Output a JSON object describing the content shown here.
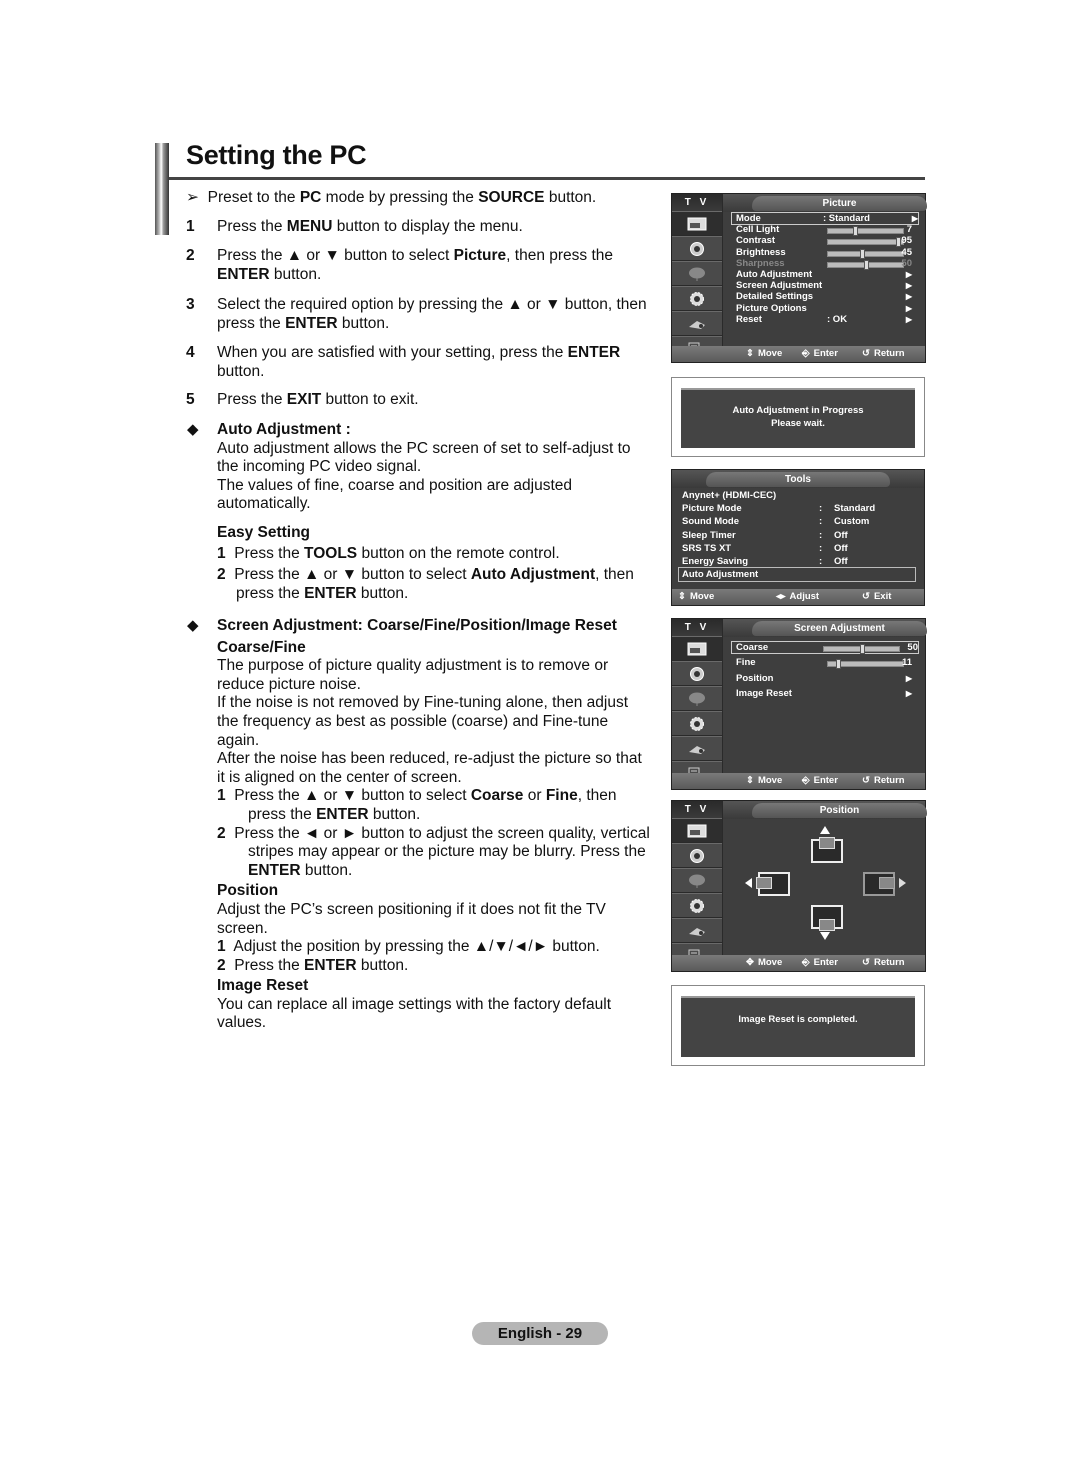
{
  "page": {
    "title": "Setting the PC",
    "footer": "English - 29"
  },
  "intro": {
    "preset_pre": "Preset to the ",
    "preset_b1": "PC",
    "preset_mid": " mode by pressing the ",
    "preset_b2": "SOURCE",
    "preset_post": " button."
  },
  "steps": [
    {
      "num": "1",
      "pre": "Press the ",
      "b": "MENU",
      "post": " button to display the menu."
    },
    {
      "num": "2",
      "line1_pre": "Press the ▲ or ▼ button to select ",
      "line1_b": "Picture",
      "line1_post": ", then press the",
      "line2_b": "ENTER",
      "line2_post": " button."
    },
    {
      "num": "3",
      "line1": "Select the required option by pressing the ▲ or ▼ button, then",
      "line2_pre": "press the ",
      "line2_b": "ENTER",
      "line2_post": " button."
    },
    {
      "num": "4",
      "line1_pre": "When you are satisfied with your setting, press the ",
      "line1_b": "ENTER",
      "line2": "button."
    },
    {
      "num": "5",
      "pre": "Press the ",
      "b": "EXIT",
      "post": " button to exit."
    }
  ],
  "auto_adjustment": {
    "bullet": "◆",
    "heading": "Auto Adjustment :",
    "lines": [
      "Auto adjustment allows the PC screen of set to self-adjust to",
      "the incoming PC video signal.",
      "The values of fine, coarse and position are adjusted",
      "automatically."
    ],
    "easy_heading": "Easy Setting",
    "easy_steps": [
      {
        "num": "1",
        "pre": "Press the ",
        "b": "TOOLS",
        "post": " button on the remote control."
      },
      {
        "num": "2",
        "pre": "Press the ▲ or ▼ button to select ",
        "b": "Auto Adjustment",
        "post": ", then",
        "line2_pre": "press the ",
        "line2_b": "ENTER",
        "line2_post": " button."
      }
    ]
  },
  "screen_adjustment": {
    "bullet": "◆",
    "heading": "Screen Adjustment: Coarse/Fine/Position/Image Reset",
    "coarse_heading": "Coarse/Fine",
    "coarse_lines": [
      "The purpose of picture quality adjustment is to remove or",
      "reduce picture noise.",
      "If the noise is not removed by Fine-tuning alone, then adjust",
      "the frequency as best as possible (coarse) and Fine-tune",
      "again.",
      "After the noise has been reduced, re-adjust the picture so that",
      "it is aligned on the center of screen."
    ],
    "coarse_steps": [
      {
        "num": "1",
        "pre": "Press the ▲ or ▼ button to select ",
        "b1": "Coarse",
        "mid": " or ",
        "b2": "Fine",
        "post": ", then",
        "line2_pre": "press the ",
        "line2_b": "ENTER",
        "line2_post": " button."
      },
      {
        "num": "2",
        "line1": "Press the ◄ or ► button to adjust the screen quality, vertical",
        "line2": "stripes may appear or the picture may be blurry. Press the",
        "line3_b": "ENTER",
        "line3_post": " button."
      }
    ],
    "position_heading": "Position",
    "position_lines": [
      "Adjust the PC’s screen positioning if it does not fit the TV",
      "screen."
    ],
    "position_steps": [
      {
        "num": "1",
        "text": "Adjust the position by pressing the ▲/▼/◄/► button."
      },
      {
        "num": "2",
        "pre": "Press the ",
        "b": "ENTER",
        "post": " button."
      }
    ],
    "reset_heading": "Image Reset",
    "reset_lines": [
      "You can replace all image settings with the factory default",
      "values."
    ]
  },
  "osd_common": {
    "tv_label": "T V",
    "move": "Move",
    "enter": "Enter",
    "return": "Return"
  },
  "picture_osd": {
    "title": "Picture",
    "items": [
      {
        "label": "Mode",
        "value": ": Standard",
        "arrow": "▶"
      },
      {
        "label": "Cell Light",
        "slider": 7,
        "max": 20
      },
      {
        "label": "Contrast",
        "slider": 95,
        "max": 100
      },
      {
        "label": "Brightness",
        "slider": 45,
        "max": 100
      },
      {
        "label": "Sharpness",
        "slider": 50,
        "max": 100
      },
      {
        "label": "Auto Adjustment",
        "arrow": "▶"
      },
      {
        "label": "Screen Adjustment",
        "arrow": "▶"
      },
      {
        "label": "Detailed Settings",
        "arrow": "▶"
      },
      {
        "label": "Picture Options",
        "arrow": "▶"
      },
      {
        "label": "Reset",
        "value": ": OK",
        "arrow": "▶"
      }
    ]
  },
  "auto_msg": {
    "line1": "Auto Adjustment in Progress",
    "line2": "Please wait."
  },
  "tools_osd": {
    "title": "Tools",
    "items": [
      {
        "label": "Anynet+ (HDMI-CEC)"
      },
      {
        "label": "Picture Mode",
        "value": "Standard"
      },
      {
        "label": "Sound Mode",
        "value": "Custom"
      },
      {
        "label": "Sleep Timer",
        "value": "Off"
      },
      {
        "label": "SRS TS XT",
        "value": "Off"
      },
      {
        "label": "Energy Saving",
        "value": "Off"
      },
      {
        "label": "Auto Adjustment"
      }
    ],
    "move": "Move",
    "adjust": "Adjust",
    "exit": "Exit"
  },
  "screen_osd": {
    "title": "Screen Adjustment",
    "items": [
      {
        "label": "Coarse",
        "slider": 50,
        "max": 100
      },
      {
        "label": "Fine",
        "slider": 11,
        "max": 100
      },
      {
        "label": "Position",
        "arrow": "▶"
      },
      {
        "label": "Image Reset",
        "arrow": "▶"
      }
    ]
  },
  "position_osd": {
    "title": "Position"
  },
  "reset_msg": {
    "line1": "Image Reset is completed."
  }
}
